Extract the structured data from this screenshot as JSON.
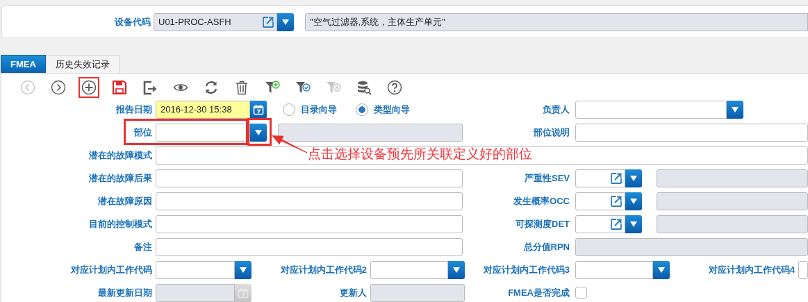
{
  "header": {
    "label": "设备代码",
    "code": "U01-PROC-ASFH",
    "description": "\"空气过滤器,系统，主体生产单元\""
  },
  "tabs": [
    {
      "label": "FMEA",
      "selected": true
    },
    {
      "label": "历史失效记录",
      "selected": false
    }
  ],
  "toolbar": [
    {
      "kind": "prev",
      "disabled": true,
      "highlighted": false
    },
    {
      "kind": "next",
      "disabled": false,
      "highlighted": false
    },
    {
      "kind": "add",
      "disabled": false,
      "highlighted": true
    },
    {
      "kind": "save",
      "disabled": false,
      "highlighted": false
    },
    {
      "kind": "export",
      "disabled": false,
      "highlighted": false
    },
    {
      "kind": "view",
      "disabled": false,
      "highlighted": false
    },
    {
      "kind": "refresh",
      "disabled": false,
      "highlighted": false
    },
    {
      "kind": "delete",
      "disabled": false,
      "highlighted": false
    },
    {
      "kind": "filter_add",
      "disabled": false,
      "highlighted": false
    },
    {
      "kind": "filter_check",
      "disabled": false,
      "highlighted": false
    },
    {
      "kind": "filter_clear",
      "disabled": true,
      "highlighted": false
    },
    {
      "kind": "database_search",
      "disabled": false,
      "highlighted": false
    },
    {
      "kind": "help",
      "disabled": false,
      "highlighted": false
    }
  ],
  "rows": [
    {
      "left": {
        "label": "报告日期",
        "highlighted": false,
        "controls": [
          {
            "kind": "date",
            "value": "2016-12-30 15:38",
            "required": true,
            "disabled": false
          },
          {
            "kind": "radios",
            "options": [
              {
                "label": "目录向导",
                "selected": false
              },
              {
                "label": "类型向导",
                "selected": true
              }
            ]
          }
        ]
      },
      "right": {
        "label": "负责人",
        "controls": [
          {
            "kind": "dropdown"
          }
        ]
      }
    },
    {
      "left": {
        "label": "部位",
        "highlighted": true,
        "controls": [
          {
            "kind": "dropdown"
          },
          {
            "kind": "readonly"
          }
        ]
      },
      "right": {
        "label": "部位说明",
        "controls": [
          {
            "kind": "text"
          }
        ]
      }
    },
    {
      "left": {
        "label": "潜在的故障模式",
        "highlighted": false,
        "controls": [
          {
            "kind": "text"
          }
        ]
      }
    },
    {
      "left": {
        "label": "潜在的故障后果",
        "highlighted": false,
        "controls": [
          {
            "kind": "text"
          }
        ]
      },
      "right": {
        "label": "严重性SEV",
        "controls": [
          {
            "kind": "lookup"
          },
          {
            "kind": "readonly"
          }
        ]
      }
    },
    {
      "left": {
        "label": "潜在故障原因",
        "highlighted": false,
        "controls": [
          {
            "kind": "text"
          }
        ]
      },
      "right": {
        "label": "发生概率OCC",
        "controls": [
          {
            "kind": "lookup"
          },
          {
            "kind": "readonly"
          }
        ]
      }
    },
    {
      "left": {
        "label": "目前的控制模式",
        "highlighted": false,
        "controls": [
          {
            "kind": "text"
          }
        ]
      },
      "right": {
        "label": "可探测度DET",
        "controls": [
          {
            "kind": "lookup"
          },
          {
            "kind": "readonly"
          }
        ]
      }
    },
    {
      "left": {
        "label": "备注",
        "highlighted": false,
        "controls": [
          {
            "kind": "text"
          }
        ]
      },
      "right": {
        "label": "总分值RPN",
        "controls": [
          {
            "kind": "readonly"
          }
        ]
      }
    }
  ],
  "bottom_rows": [
    [
      {
        "label": "对应计划内工作代码",
        "control": {
          "kind": "dropdown"
        }
      },
      {
        "label": "对应计划内工作代码2",
        "control": {
          "kind": "dropdown"
        }
      },
      {
        "label": "对应计划内工作代码3",
        "control": {
          "kind": "dropdown"
        }
      },
      {
        "label": "对应计划内工作代码4",
        "control": {
          "kind": "text"
        }
      }
    ],
    [
      {
        "label": "最新更新日期",
        "control": {
          "kind": "date",
          "disabled": true
        }
      },
      {
        "label": "更新人",
        "control": {
          "kind": "readonly"
        }
      },
      {
        "label": "FMEA是否完成",
        "control": {
          "kind": "checkbox",
          "checked": false
        }
      }
    ]
  ],
  "annotation": {
    "text": "点击选择设备预先所关联定义好的部位"
  }
}
